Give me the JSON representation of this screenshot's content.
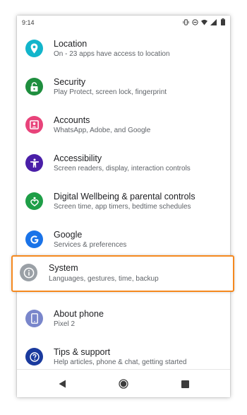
{
  "status_bar": {
    "time": "9:14",
    "icons": [
      "vibrate-icon",
      "do-not-disturb-icon",
      "wifi-icon",
      "signal-icon",
      "battery-icon"
    ]
  },
  "settings": {
    "items": [
      {
        "title": "Location",
        "subtitle": "On - 23 apps have access to location",
        "icon": "location-pin-icon",
        "color": "#12b5cb"
      },
      {
        "title": "Security",
        "subtitle": "Play Protect, screen lock, fingerprint",
        "icon": "lock-icon",
        "color": "#1e8e3e"
      },
      {
        "title": "Accounts",
        "subtitle": "WhatsApp, Adobe, and Google",
        "icon": "account-box-icon",
        "color": "#e8437a"
      },
      {
        "title": "Accessibility",
        "subtitle": "Screen readers, display, interaction controls",
        "icon": "accessibility-icon",
        "color": "#4a1fa8"
      },
      {
        "title": "Digital Wellbeing & parental controls",
        "subtitle": "Screen time, app timers, bedtime schedules",
        "icon": "wellbeing-heart-icon",
        "color": "#1e9e47"
      },
      {
        "title": "Google",
        "subtitle": "Services & preferences",
        "icon": "google-g-icon",
        "color": "#1a73e8"
      }
    ],
    "system": {
      "title": "System",
      "subtitle": "Languages, gestures, time, backup",
      "icon": "info-icon",
      "color": "#9aa0a6"
    },
    "after": [
      {
        "title": "About phone",
        "subtitle": "Pixel 2",
        "icon": "phone-icon",
        "color": "#7986cb"
      },
      {
        "title": "Tips & support",
        "subtitle": "Help articles, phone & chat, getting started",
        "icon": "help-icon",
        "color": "#1a3a9e"
      }
    ]
  },
  "highlight_color": "#f5891f",
  "nav_bar": {
    "buttons": [
      "back-icon",
      "home-icon",
      "recents-icon"
    ]
  }
}
